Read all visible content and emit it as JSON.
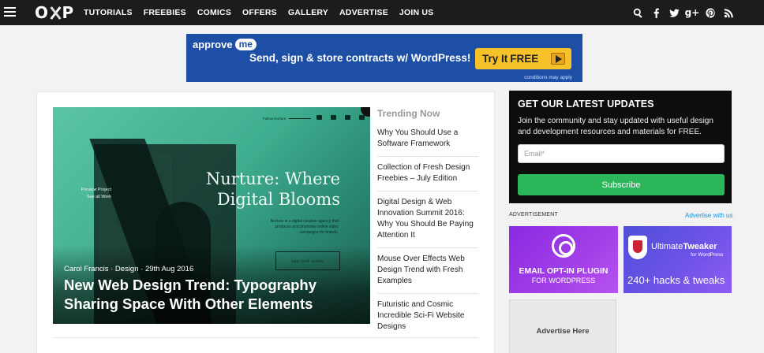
{
  "nav": {
    "logo": "OXP",
    "items": [
      "TUTORIALS",
      "FREEBIES",
      "COMICS",
      "OFFERS",
      "GALLERY",
      "ADVERTISE",
      "JOIN US"
    ],
    "social_icons": [
      "search-icon",
      "facebook-icon",
      "twitter-icon",
      "google-plus-icon",
      "pinterest-icon",
      "rss-icon"
    ]
  },
  "banner": {
    "brand": "approve",
    "brand_me": "me",
    "tagline": "Send, sign & store contracts w/ WordPress!",
    "cta_prefix": "Try It",
    "cta_free": "FREE",
    "note": "conditions may apply"
  },
  "featured": {
    "image_follow": "Follow Nurture",
    "image_title": "Nurture: Where Digital Blooms",
    "image_desc": "Nurture is a digital creative agency that produces and promotes online video campaigns for brands.",
    "image_preview": "Preview Project",
    "image_see": "See all Work",
    "image_button": "SEE OUR WORK",
    "meta": "Carol Francis · Design · 29th Aug 2016",
    "title": "New Web Design Trend: Typography Sharing Space With Other Elements"
  },
  "trending": {
    "heading": "Trending Now",
    "items": [
      "Why You Should Use a Software Framework",
      "Collection of Fresh Design Freebies – July Edition",
      "Digital Design & Web Innovation Summit 2016: Why You Should Be Paying Attention It",
      "Mouse Over Effects Web Design Trend with Fresh Examples",
      "Futuristic and Cosmic Incredible Sci-Fi Website Designs"
    ]
  },
  "signup": {
    "heading": "GET OUR LATEST UPDATES",
    "text": "Join the community and stay updated with useful design and development resources and materials for FREE.",
    "email_placeholder": "Email*",
    "button": "Subscribe"
  },
  "ads": {
    "label": "ADVERTISEMENT",
    "link": "Advertise with us",
    "ad1_line1": "EMAIL OPT-IN PLUGIN",
    "ad1_line2": "FOR WORDPRESS",
    "ad2_name_a": "Ultimate",
    "ad2_name_b": "Tweaker",
    "ad2_sub": "for WordPress",
    "ad2_hacks": "240+ hacks & tweaks",
    "ad3": "Advertise Here"
  },
  "colors": {
    "topbar": "#1c1c1c",
    "banner": "#1d4fa6",
    "cta": "#f7c12a",
    "subscribe": "#2cb65a",
    "link": "#1a8fd6",
    "ad1": "#a43fe7",
    "ad2": "#6d53e6"
  }
}
